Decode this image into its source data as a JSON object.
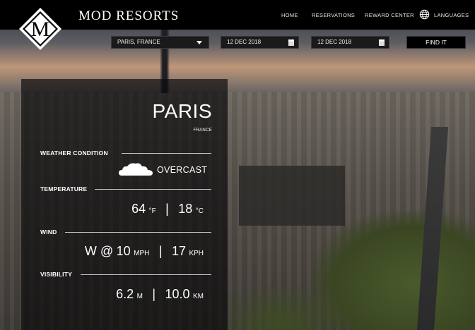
{
  "header": {
    "brand": "MOD RESORTS",
    "logo_letter": "M",
    "nav": [
      "HOME",
      "RESERVATIONS",
      "REWARD CENTER",
      "LANGUAGES"
    ]
  },
  "search": {
    "destination": "PARIS, FRANCE",
    "checkin": "12 DEC 2018",
    "checkout": "12 DEC 2018",
    "button": "FIND IT"
  },
  "weather": {
    "city": "PARIS",
    "country": "FRANCE",
    "condition_label": "WEATHER CONDITION",
    "condition": "OVERCAST",
    "temperature_label": "TEMPERATURE",
    "temp_f": "64",
    "temp_f_unit": "°F",
    "temp_c": "18",
    "temp_c_unit": "°C",
    "wind_label": "WIND",
    "wind_dir": "W @",
    "wind_mph": "10",
    "wind_mph_unit": "MPH",
    "wind_kph": "17",
    "wind_kph_unit": "KPH",
    "visibility_label": "VISIBILITY",
    "vis_m": "6.2",
    "vis_m_unit": "M",
    "vis_km": "10.0",
    "vis_km_unit": "KM",
    "separator": "|"
  },
  "colors": {
    "header_bg": "#000000",
    "panel_bg": "rgba(10,10,12,0.68)",
    "field_bg": "#1a1a1a"
  },
  "icons": {
    "logo": "diamond-m-logo",
    "globe": "globe-icon",
    "calendar": "calendar-icon",
    "dropdown": "caret-down-icon",
    "weather": "cloud-icon"
  }
}
